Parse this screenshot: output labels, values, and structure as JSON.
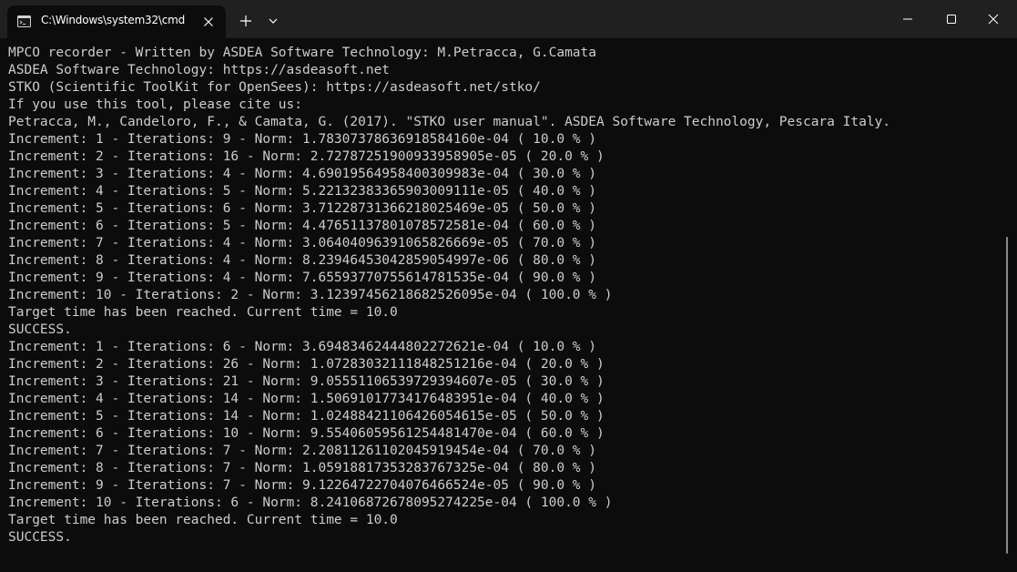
{
  "window": {
    "tab_title": "C:\\Windows\\system32\\cmd",
    "icons": {
      "tab_icon": "terminal-icon",
      "tab_close": "close-icon",
      "new_tab": "plus-icon",
      "dropdown": "chevron-down-icon",
      "minimize": "minimize-icon",
      "maximize": "maximize-icon",
      "close": "close-icon"
    }
  },
  "colors": {
    "background": "#0c0c0c",
    "titlebar": "#202020",
    "text": "#cccccc"
  },
  "terminal": {
    "lines": [
      "MPCO recorder - Written by ASDEA Software Technology: M.Petracca, G.Camata",
      "ASDEA Software Technology: https://asdeasoft.net",
      "STKO (Scientific ToolKit for OpenSees): https://asdeasoft.net/stko/",
      "If you use this tool, please cite us:",
      "Petracca, M., Candeloro, F., & Camata, G. (2017). \"STKO user manual\". ASDEA Software Technology, Pescara Italy.",
      "Increment: 1 - Iterations: 9 - Norm: 1.78307378636918584160e-04 ( 10.0 % )",
      "Increment: 2 - Iterations: 16 - Norm: 2.72787251900933958905e-05 ( 20.0 % )",
      "Increment: 3 - Iterations: 4 - Norm: 4.69019564958400309983e-04 ( 30.0 % )",
      "Increment: 4 - Iterations: 5 - Norm: 5.22132383365903009111e-05 ( 40.0 % )",
      "Increment: 5 - Iterations: 6 - Norm: 3.71228731366218025469e-05 ( 50.0 % )",
      "Increment: 6 - Iterations: 5 - Norm: 4.47651137801078572581e-04 ( 60.0 % )",
      "Increment: 7 - Iterations: 4 - Norm: 3.06404096391065826669e-05 ( 70.0 % )",
      "Increment: 8 - Iterations: 4 - Norm: 8.23946453042859054997e-06 ( 80.0 % )",
      "Increment: 9 - Iterations: 4 - Norm: 7.65593770755614781535e-04 ( 90.0 % )",
      "Increment: 10 - Iterations: 2 - Norm: 3.12397456218682526095e-04 ( 100.0 % )",
      "Target time has been reached. Current time = 10.0",
      "SUCCESS.",
      "Increment: 1 - Iterations: 6 - Norm: 3.69483462444802272621e-04 ( 10.0 % )",
      "Increment: 2 - Iterations: 26 - Norm: 1.07283032111848251216e-04 ( 20.0 % )",
      "Increment: 3 - Iterations: 21 - Norm: 9.05551106539729394607e-05 ( 30.0 % )",
      "Increment: 4 - Iterations: 14 - Norm: 1.50691017734176483951e-04 ( 40.0 % )",
      "Increment: 5 - Iterations: 14 - Norm: 1.02488421106426054615e-05 ( 50.0 % )",
      "Increment: 6 - Iterations: 10 - Norm: 9.55406059561254481470e-04 ( 60.0 % )",
      "Increment: 7 - Iterations: 7 - Norm: 2.20811261102045919454e-04 ( 70.0 % )",
      "Increment: 8 - Iterations: 7 - Norm: 1.05918817353283767325e-04 ( 80.0 % )",
      "Increment: 9 - Iterations: 7 - Norm: 9.12264722704076466524e-05 ( 90.0 % )",
      "Increment: 10 - Iterations: 6 - Norm: 8.24106872678095274225e-04 ( 100.0 % )",
      "Target time has been reached. Current time = 10.0",
      "SUCCESS."
    ]
  }
}
